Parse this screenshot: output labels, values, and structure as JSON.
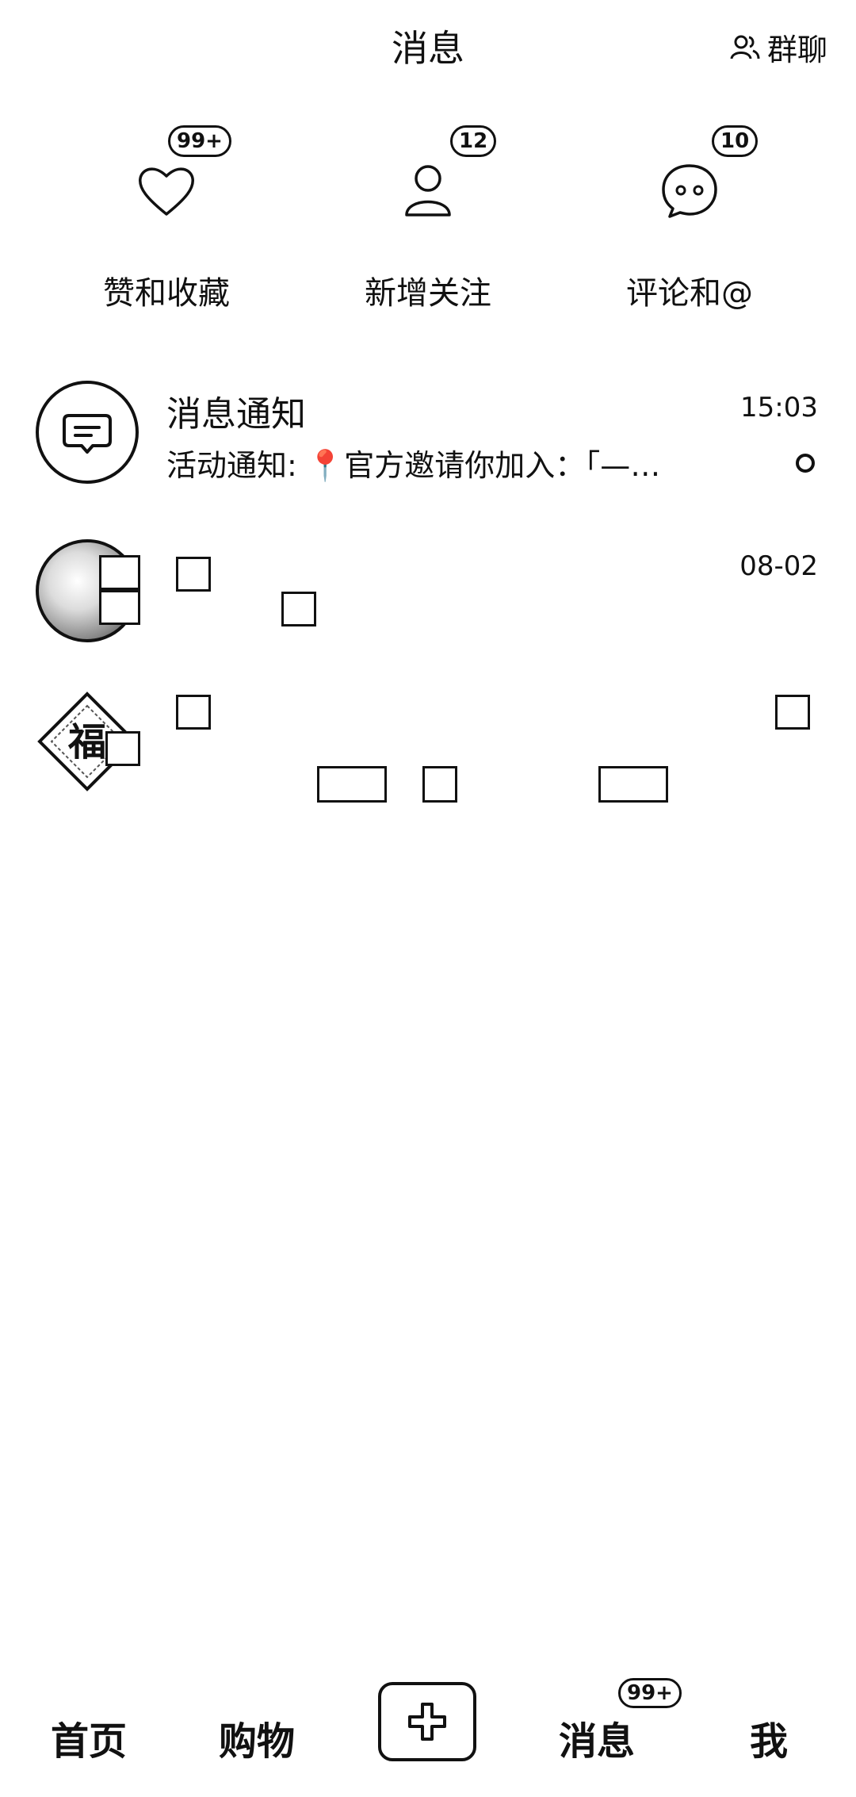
{
  "header": {
    "title": "消息",
    "group_chat_label": "群聊"
  },
  "quick_entries": [
    {
      "label": "赞和收藏",
      "badge": "99+",
      "icon": "heart-icon"
    },
    {
      "label": "新增关注",
      "badge": "12",
      "icon": "person-icon"
    },
    {
      "label": "评论和@",
      "badge": "10",
      "icon": "chat-bubble-icon"
    }
  ],
  "messages": [
    {
      "name": "消息通知",
      "preview": "活动通知: 📍官方邀请你加入：「—…",
      "time": "15:03",
      "icon": "message-notice-icon"
    },
    {
      "name": "",
      "preview": "",
      "time": "08-02",
      "icon": "avatar-photo"
    },
    {
      "name": "",
      "preview": "",
      "time": "",
      "icon": "avatar-fu"
    }
  ],
  "bottom_nav": {
    "home": "首页",
    "shop": "购物",
    "add_icon": "plus-icon",
    "messages": "消息",
    "messages_badge": "99+",
    "me": "我"
  }
}
